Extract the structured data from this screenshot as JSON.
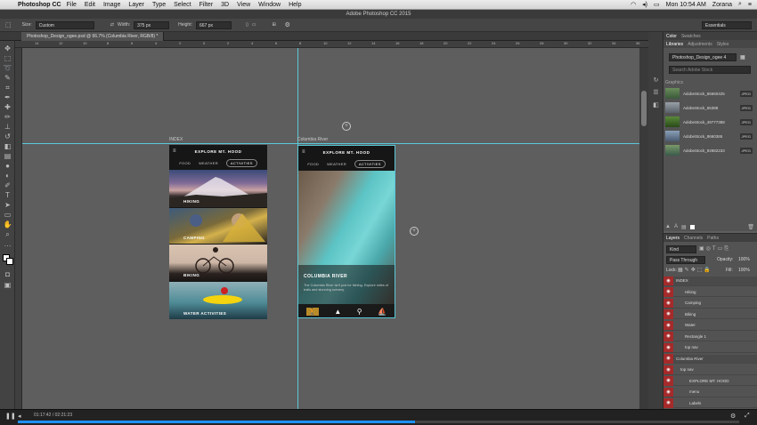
{
  "menubar": {
    "app": "Photoshop CC",
    "items": [
      "File",
      "Edit",
      "Image",
      "Layer",
      "Type",
      "Select",
      "Filter",
      "3D",
      "View",
      "Window",
      "Help"
    ],
    "clock": "Mon 10:54 AM",
    "user": "Zorana"
  },
  "window_title": "Adobe Photoshop CC 2015",
  "options_bar": {
    "size_label": "Size:",
    "size_value": "Custom",
    "width_label": "Width:",
    "width_value": "375 px",
    "height_label": "Height:",
    "height_value": "667 px",
    "workspace": "Essentials"
  },
  "document_tab": "Photoshop_Design_ogee.psd @ 66.7% (Columbia River, RGB/8) *",
  "ruler_ticks": [
    "14",
    "12",
    "10",
    "8",
    "6",
    "4",
    "2",
    "0",
    "2",
    "4",
    "6",
    "8",
    "10",
    "12",
    "14",
    "16",
    "18",
    "20",
    "22",
    "24",
    "26",
    "28",
    "30",
    "32",
    "34",
    "36"
  ],
  "artboards": {
    "index": {
      "label": "INDEX",
      "header": "EXPLORE MT. HOOD",
      "tabs": [
        "FOOD",
        "WEATHER",
        "ACTIVITIES"
      ],
      "cards": [
        "HIKING",
        "CAMPING",
        "BIKING",
        "WATER ACTIVITIES"
      ]
    },
    "river": {
      "label": "Columbia River",
      "header": "EXPLORE MT. HOOD",
      "tabs": [
        "FOOD",
        "WEATHER",
        "ACTIVITIES"
      ],
      "title": "COLUMBIA RIVER",
      "desc": "The Columbia River isn't just for fishing. Explore miles of trails and stunning scenery."
    }
  },
  "libraries": {
    "tabs": [
      "Libraries",
      "Adjustments",
      "Styles"
    ],
    "color_tabs": [
      "Color",
      "Swatches"
    ],
    "library_name": "Photoshop_Design_ogee 4",
    "search_placeholder": "Search Adobe Stock",
    "section": "Graphics",
    "items": [
      {
        "name": "AdobeStock_86660425",
        "type": "JPEG"
      },
      {
        "name": "AdobeStock_65388",
        "type": "JPEG"
      },
      {
        "name": "AdobeStock_49777388",
        "type": "JPEG"
      },
      {
        "name": "AdobeStock_8660365",
        "type": "JPEG"
      },
      {
        "name": "AdobeStock_92882233",
        "type": "JPEG"
      }
    ]
  },
  "layers": {
    "tabs": [
      "Layers",
      "Channels",
      "Paths"
    ],
    "kind": "Kind",
    "blend": "Pass Through",
    "opacity_label": "Opacity:",
    "opacity": "100%",
    "lock_label": "Lock:",
    "fill_label": "Fill:",
    "fill": "100%",
    "rows": [
      {
        "name": "INDEX",
        "indent": 0
      },
      {
        "name": "Hiking",
        "indent": 2
      },
      {
        "name": "Camping",
        "indent": 2
      },
      {
        "name": "Biking",
        "indent": 2
      },
      {
        "name": "Water",
        "indent": 2
      },
      {
        "name": "Rectangle 1",
        "indent": 2
      },
      {
        "name": "top nav",
        "indent": 2
      },
      {
        "name": "Columbia River",
        "indent": 0
      },
      {
        "name": "top nav",
        "indent": 1
      },
      {
        "name": "EXPLORE MT. HOOD",
        "indent": 3
      },
      {
        "name": "menu",
        "indent": 3
      },
      {
        "name": "Labels",
        "indent": 3
      }
    ]
  },
  "status": {
    "time": "01:17:42 / 02:21:23"
  },
  "progress": 0.55,
  "colors": {
    "guide": "#5ac8d8",
    "accent": "#1e90ff",
    "eye": "#a52a2a"
  }
}
